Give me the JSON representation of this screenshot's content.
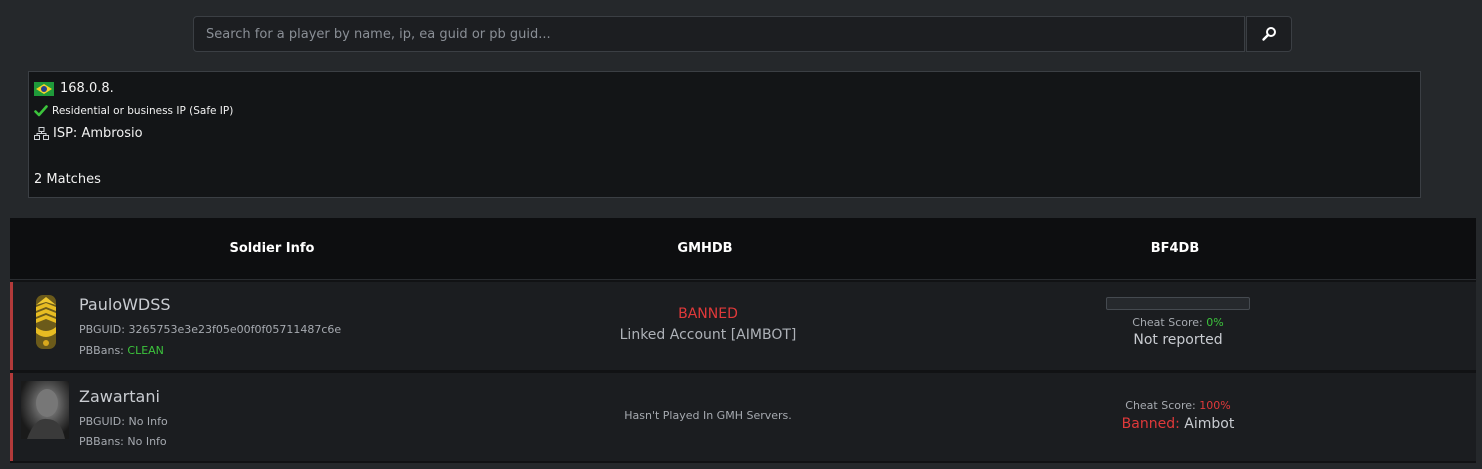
{
  "search": {
    "placeholder": "Search for a player by name, ip, ea guid or pb guid...",
    "button_icon": "search-icon"
  },
  "ip_info": {
    "flag_icon": "brazil-flag-icon",
    "ip": "168.0.8.",
    "safe_text": "Residential or business IP (Safe IP)",
    "isp_text": "ISP: Ambrosio",
    "matches_text": "2 Matches"
  },
  "table": {
    "headers": [
      "Soldier Info",
      "GMHDB",
      "BF4DB"
    ],
    "rows": [
      {
        "name": "PauloWDSS",
        "avatar_icon": "rank-insignia-icon",
        "pbguid": "PBGUID: 3265753e3e23f05e00f0f05711487c6e",
        "pbbans_label": "PBBans:",
        "pbbans_value": "CLEAN",
        "gmhdb_status": "BANNED",
        "gmhdb_detail": "Linked Account [AIMBOT]",
        "cheat_label": "Cheat Score:",
        "cheat_value": "0%",
        "cheat_fraction": 0,
        "bf4db_status": "Not reported"
      },
      {
        "name": "Zawartani",
        "avatar_icon": "player-photo-avatar",
        "pbguid": "PBGUID: No Info",
        "pbbans_label": "PBBans:",
        "pbbans_value": "No Info",
        "gmhdb_detail": "Hasn't Played In GMH Servers.",
        "cheat_label": "Cheat Score:",
        "cheat_value": "100%",
        "banned_label": "Banned:",
        "banned_reason": "Aimbot"
      }
    ]
  },
  "colors": {
    "accent_red": "#e0393a",
    "accent_green": "#3cc43c",
    "background": "#25282b"
  }
}
